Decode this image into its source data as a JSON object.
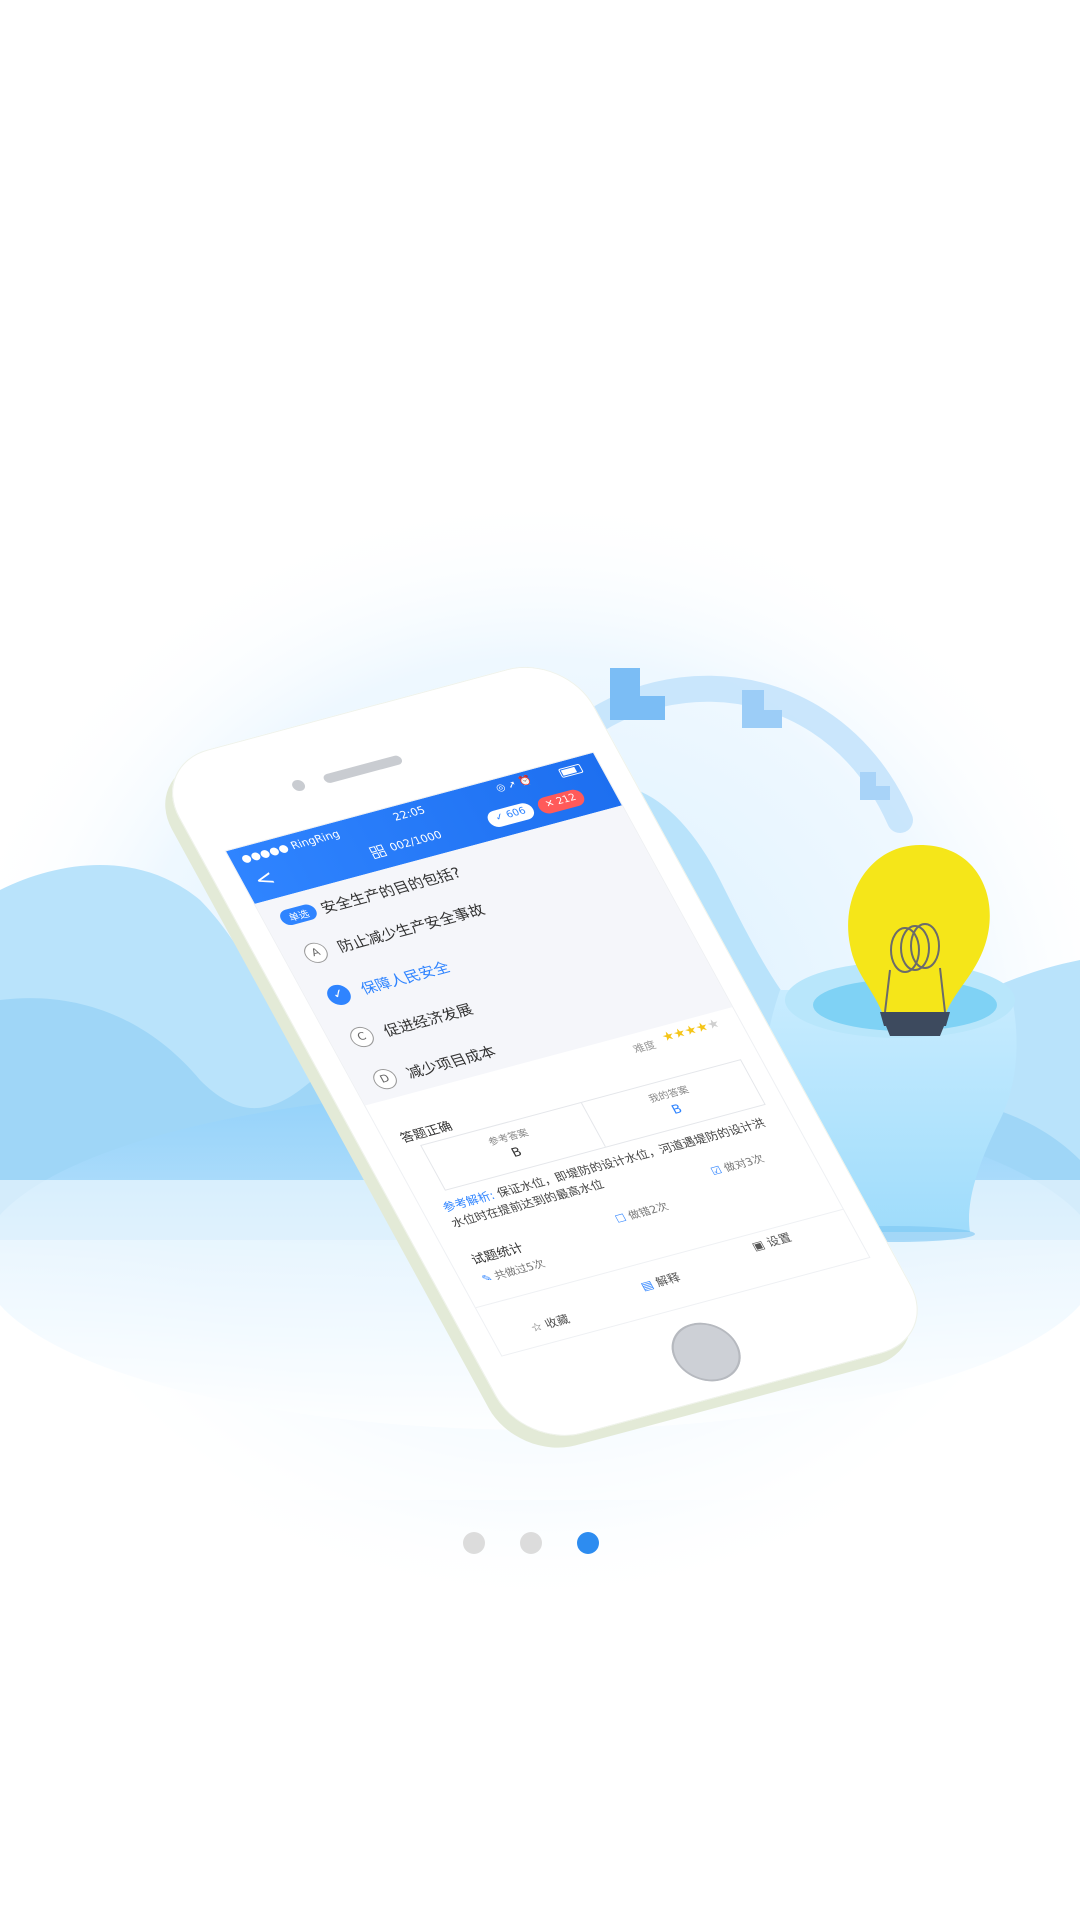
{
  "phone": {
    "status": {
      "carrier": "●●●●● RingRing",
      "time": "22:05",
      "icons": "◎ ➚ ⏰"
    },
    "nav": {
      "back": "<",
      "progress": "002/1000",
      "right_count": "✓ 606",
      "wrong_count": "✕ 212"
    },
    "question": {
      "type_badge": "单选",
      "text": "安全生产的目的包括?",
      "options": [
        {
          "letter": "A",
          "text": "防止减少生产安全事故"
        },
        {
          "letter": "✓",
          "text": "保障人民安全"
        },
        {
          "letter": "C",
          "text": "促进经济发展"
        },
        {
          "letter": "D",
          "text": "减少项目成本"
        }
      ]
    },
    "difficulty_label": "难度",
    "difficulty_stars": 4,
    "stars": "★★★★",
    "star_off": "★",
    "result_title": "答题正确",
    "reference_answer_label": "参考答案",
    "reference_answer": "B",
    "my_answer_label": "我的答案",
    "my_answer": "B",
    "analysis_label": "参考解析:",
    "analysis_text": "保证水位，即堤防的设计水位，河道遇堤防的设计洪水位时在提前达到的最高水位",
    "stats_title": "试题统计",
    "stat_right": "做对3次",
    "stat_wrong": "做错2次",
    "stat_total": "共做过5次",
    "tabs": {
      "favorite": "收藏",
      "explain": "解释",
      "settings": "设置"
    }
  },
  "pager": {
    "count": 3,
    "active_index": 2,
    "active_color": "#2d8cf0",
    "inactive_color": "#dcdcdc"
  },
  "colors": {
    "primary": "#2f84ff",
    "bulb": "#f5e619",
    "mountain_light": "#a9dcf8",
    "mountain_dark": "#7cc6f4"
  }
}
